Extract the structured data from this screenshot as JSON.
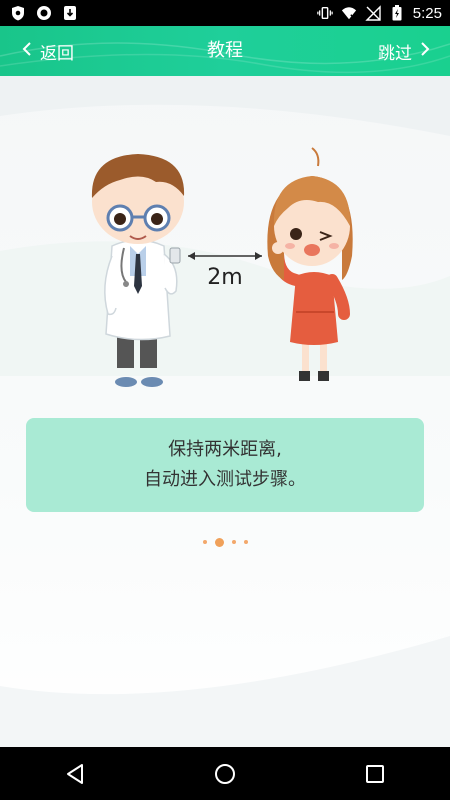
{
  "status_bar": {
    "time": "5:25",
    "icons": [
      "shield-icon",
      "record-icon",
      "download-icon",
      "vibrate-icon",
      "wifi-icon",
      "no-sim-icon",
      "battery-charging-icon"
    ]
  },
  "header": {
    "back_label": "返回",
    "title": "教程",
    "skip_label": "跳过",
    "color": "#1cc98e"
  },
  "illustration": {
    "distance_label": "2m",
    "left_figure": "doctor",
    "right_figure": "girl"
  },
  "tip": {
    "line1": "保持两米距离,",
    "line2": "自动进入测试步骤。",
    "background": "#a9ead4"
  },
  "pager": {
    "pages": 4,
    "current": 2,
    "color": "#f0a15a"
  },
  "nav_bar": {
    "buttons": [
      "back-icon",
      "home-icon",
      "recents-icon"
    ]
  }
}
